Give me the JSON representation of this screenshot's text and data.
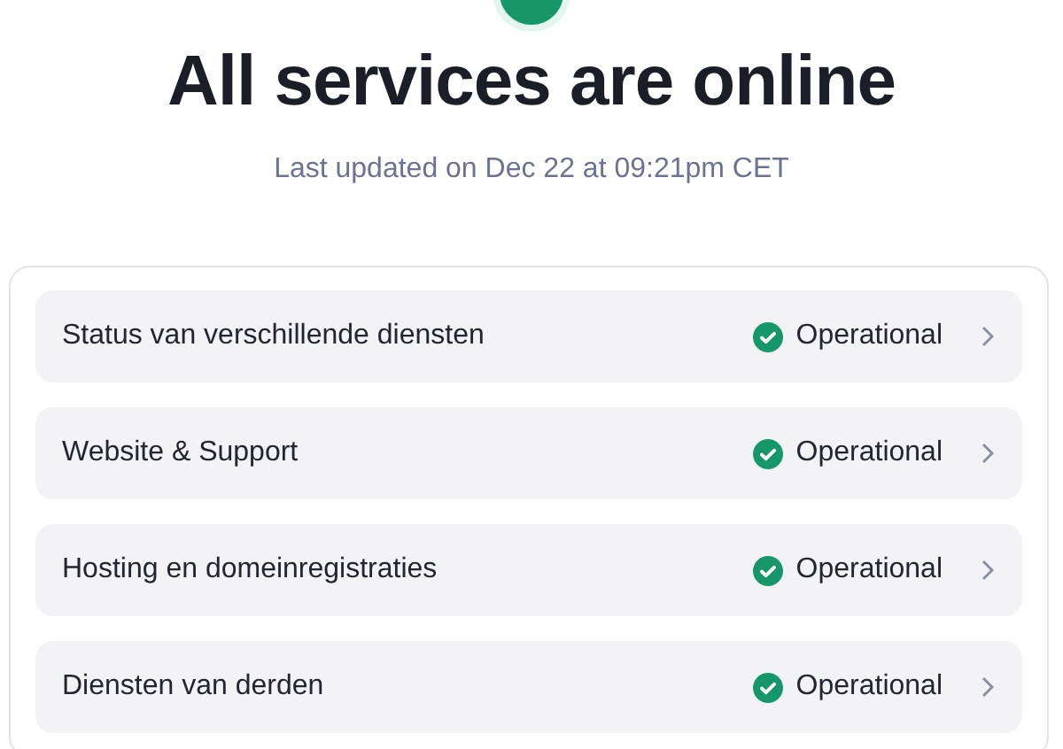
{
  "header": {
    "title": "All services are online",
    "last_updated": "Last updated on Dec 22 at 09:21pm CET",
    "online": true
  },
  "services": [
    {
      "name": "Status van verschillende diensten",
      "operational": true,
      "status_label": "Operational"
    },
    {
      "name": "Website & Support",
      "operational": true,
      "status_label": "Operational"
    },
    {
      "name": "Hosting en domeinregistraties",
      "operational": true,
      "status_label": "Operational"
    },
    {
      "name": "Diensten van derden",
      "operational": true,
      "status_label": "Operational"
    }
  ]
}
